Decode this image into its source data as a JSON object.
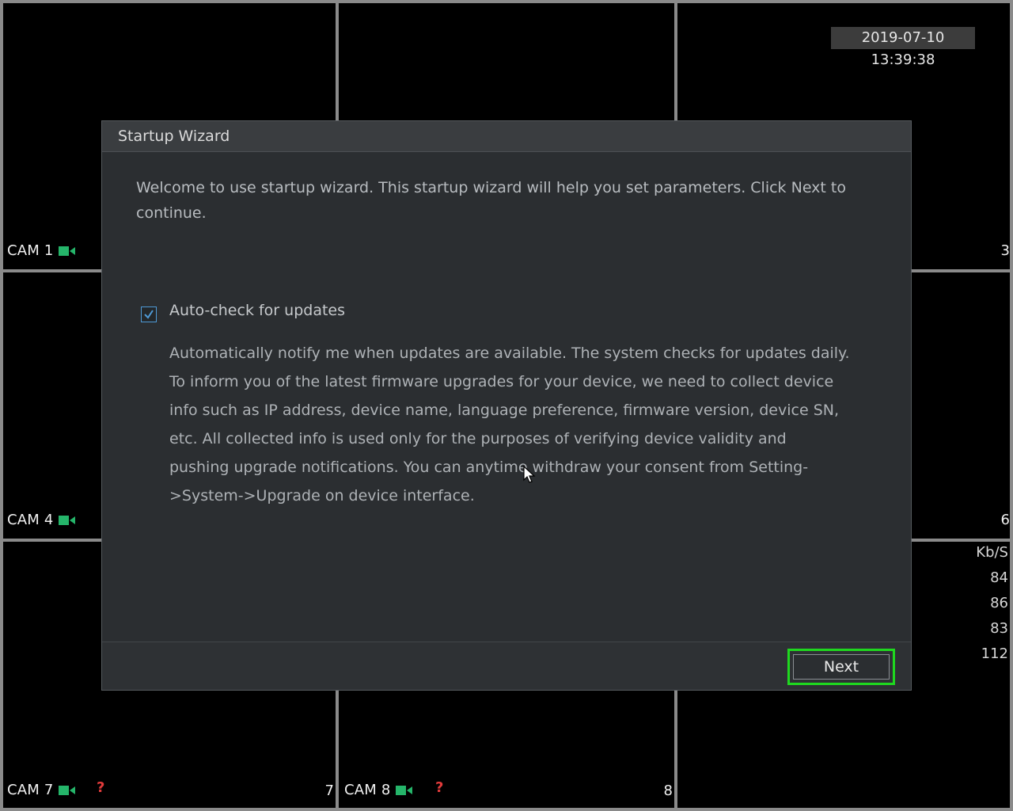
{
  "overlay": {
    "datetime": "2019-07-10 13:39:38",
    "bitrate_header": "Kb/S",
    "bitrates": [
      "84",
      "86",
      "83",
      "112"
    ]
  },
  "cameras": {
    "cam1_label": "CAM 1",
    "cam4_label": "CAM 4",
    "cam7_label": "CAM 7",
    "cam8_label": "CAM 8",
    "ch3_number": "3",
    "ch6_number": "6",
    "ch7_number": "7",
    "ch8_number": "8",
    "warning_glyph": "?"
  },
  "dialog": {
    "title": "Startup Wizard",
    "welcome_text": "Welcome to use startup wizard. This startup wizard will help you set parameters. Click Next to continue.",
    "auto_check_label": "Auto-check for updates",
    "auto_check_checked": true,
    "description": "Automatically notify me when updates are available. The system checks for updates daily. To inform you of the latest firmware upgrades for your device, we need to collect device info such as IP address, device name, language preference, firmware version, device SN, etc. All collected info is used only for the purposes of verifying device validity and pushing upgrade notifications. You can anytime withdraw your consent from Setting->System->Upgrade on device interface.",
    "next_label": "Next"
  },
  "colors": {
    "accent_highlight": "#1fd81f",
    "record_icon": "#25b56a",
    "warning": "#e23b3b",
    "checkbox": "#4f9ad6"
  }
}
